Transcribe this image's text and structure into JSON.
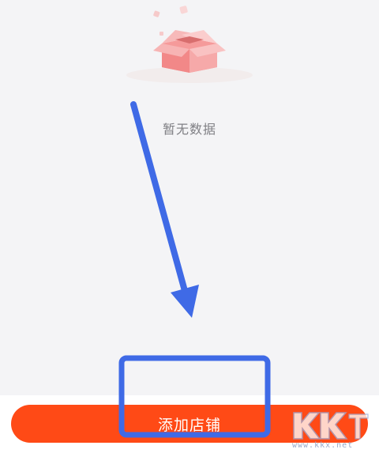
{
  "empty_state": {
    "illustration_icon": "open-box-icon",
    "message": "暂无数据"
  },
  "footer": {
    "add_shop_label": "添加店铺"
  },
  "annotation": {
    "arrow_color": "#3f6ae6",
    "highlight_color": "#3f6ae6"
  },
  "watermark": {
    "logo_text": "KK下载",
    "url": "www.kkx.net"
  },
  "colors": {
    "background": "#f4f4f6",
    "accent": "#ff4a16",
    "muted_text": "#7f7f84"
  }
}
